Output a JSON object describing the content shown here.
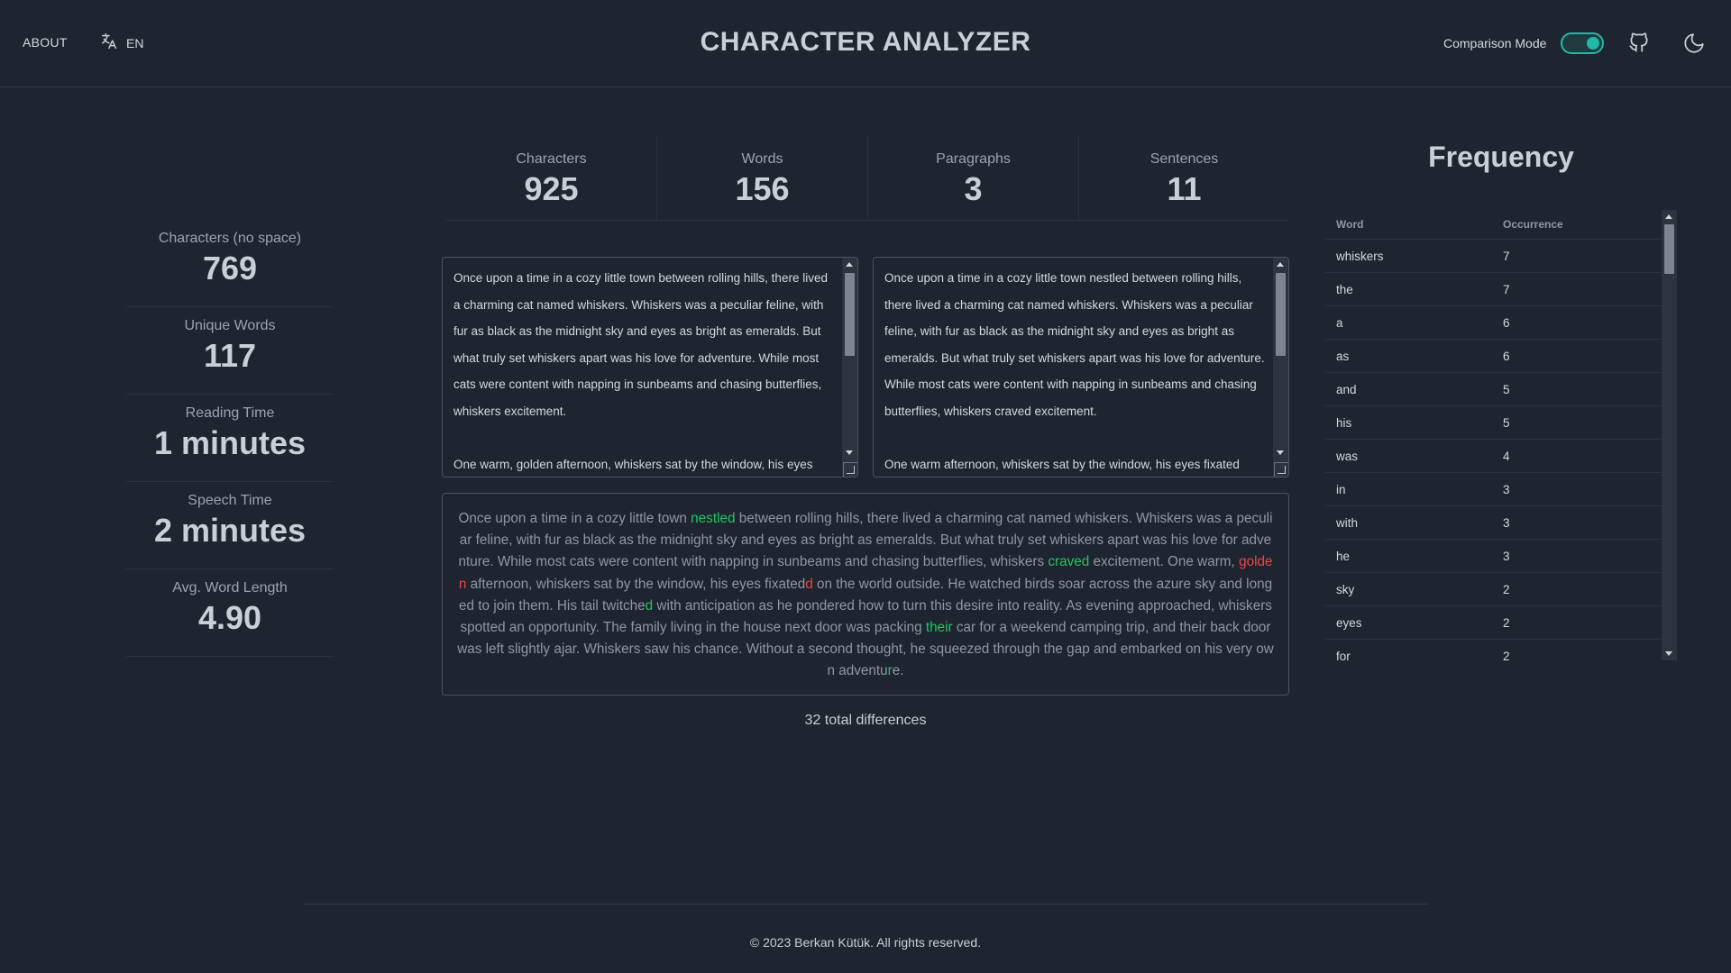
{
  "header": {
    "about": "ABOUT",
    "language": "EN",
    "title": "CHARACTER ANALYZER",
    "comparison_mode_label": "Comparison Mode",
    "comparison_mode_on": true,
    "accent_color": "#1fb9a8",
    "icons": [
      "translate-icon",
      "github-icon",
      "moon-icon"
    ]
  },
  "top_stats": [
    {
      "label": "Characters",
      "value": "925"
    },
    {
      "label": "Words",
      "value": "156"
    },
    {
      "label": "Paragraphs",
      "value": "3"
    },
    {
      "label": "Sentences",
      "value": "11"
    }
  ],
  "side_stats": [
    {
      "label": "Characters (no space)",
      "value": "769"
    },
    {
      "label": "Unique Words",
      "value": "117"
    },
    {
      "label": "Reading Time",
      "value": "1 minutes"
    },
    {
      "label": "Speech Time",
      "value": "2 minutes"
    },
    {
      "label": "Avg. Word Length",
      "value": "4.90"
    }
  ],
  "text_left": {
    "p1": "Once upon a time in a cozy little town between rolling hills, there lived a charming cat named whiskers. Whiskers was a peculiar feline, with fur as black as the midnight sky and eyes as bright as emeralds. But what truly set whiskers apart was his love for adventure. While most cats were content with napping in sunbeams and chasing butterflies, whiskers  excitement.",
    "p2": "One warm, golden afternoon, whiskers sat by the window, his eyes"
  },
  "text_right": {
    "p1": "Once upon a time in a cozy little town nestled between rolling hills, there lived a charming cat named whiskers. Whiskers was a peculiar feline, with fur as black as the midnight sky and eyes as bright as emeralds. But what truly set whiskers apart was his love for adventure. While most cats were content with napping in sunbeams and chasing butterflies, whiskers craved excitement.",
    "p2": "One warm afternoon, whiskers sat by the window, his eyes fixated"
  },
  "diff": {
    "segments": [
      {
        "t": "Once upon a time in a cozy little town ",
        "k": "same"
      },
      {
        "t": "nestled",
        "k": "added"
      },
      {
        "t": " between rolling hills, there lived a charming cat named whiskers. Whiskers was a peculiar feline, with fur as black as the midnight sky and eyes as bright as emeralds. But what truly set whiskers apart was his love for adventure. While most cats were content with napping in sunbeams and chasing butterflies, whiskers ",
        "k": "same"
      },
      {
        "t": "craved",
        "k": "added"
      },
      {
        "t": " excitement. One warm, ",
        "k": "same"
      },
      {
        "t": "golden",
        "k": "removed"
      },
      {
        "t": " afternoon, whiskers sat by the window, his eyes fixated",
        "k": "same"
      },
      {
        "t": "d",
        "k": "removed"
      },
      {
        "t": " on the world outside. He watched birds soar across the azure sky and longed to join them. His tail twitche",
        "k": "same"
      },
      {
        "t": "d",
        "k": "added"
      },
      {
        "t": " with anticipation as he pondered how to turn this desire into reality. As evening approached, whiskers spotted an opportunity. The family living in the house next door was packing ",
        "k": "same"
      },
      {
        "t": "their",
        "k": "added"
      },
      {
        "t": " car for a weekend camping trip, and their back door was left slightly ajar. Whiskers saw his chance. Without a second thought, he squeezed through the gap and embarked on his very own adventu",
        "k": "same"
      },
      {
        "t": "r",
        "k": "added"
      },
      {
        "t": "e.",
        "k": "same"
      }
    ],
    "total": "32 total differences",
    "added_color": "#22c55e",
    "removed_color": "#ef4444"
  },
  "frequency": {
    "title": "Frequency",
    "col_word": "Word",
    "col_occurrence": "Occurrence",
    "rows": [
      {
        "word": "whiskers",
        "count": "7"
      },
      {
        "word": "the",
        "count": "7"
      },
      {
        "word": "a",
        "count": "6"
      },
      {
        "word": "as",
        "count": "6"
      },
      {
        "word": "and",
        "count": "5"
      },
      {
        "word": "his",
        "count": "5"
      },
      {
        "word": "was",
        "count": "4"
      },
      {
        "word": "in",
        "count": "3"
      },
      {
        "word": "with",
        "count": "3"
      },
      {
        "word": "he",
        "count": "3"
      },
      {
        "word": "sky",
        "count": "2"
      },
      {
        "word": "eyes",
        "count": "2"
      },
      {
        "word": "for",
        "count": "2"
      }
    ]
  },
  "footer": {
    "copyright": "© 2023 Berkan Kütük. All rights reserved."
  }
}
